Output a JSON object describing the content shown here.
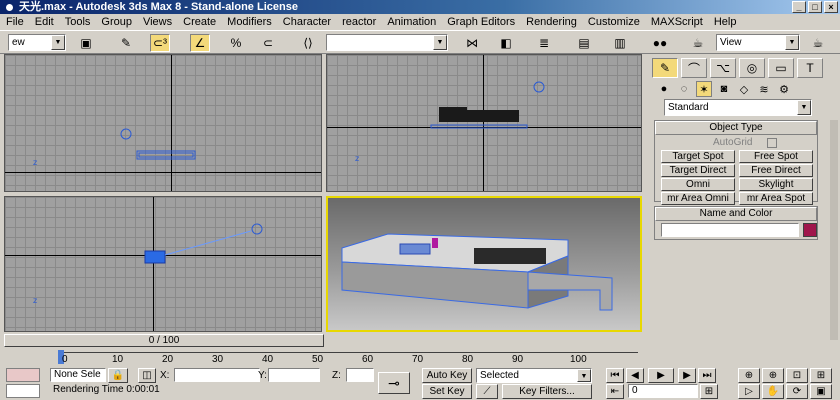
{
  "window": {
    "title": "天光.max - Autodesk 3ds Max 8 - Stand-alone License"
  },
  "menu": [
    "File",
    "Edit",
    "Tools",
    "Group",
    "Views",
    "Create",
    "Modifiers",
    "Character",
    "reactor",
    "Animation",
    "Graph Editors",
    "Rendering",
    "Customize",
    "MAXScript",
    "Help"
  ],
  "toolbar": {
    "selection_filter": "ew",
    "named_selection": "",
    "render_view": "View"
  },
  "command_panel": {
    "dropdown": "Standard",
    "object_type": {
      "title": "Object Type",
      "autogrid": "AutoGrid",
      "buttons": [
        "Target Spot",
        "Free Spot",
        "Target Direct",
        "Free Direct",
        "Omni",
        "Skylight",
        "mr Area Omni",
        "mr Area Spot"
      ]
    },
    "name_color": {
      "title": "Name and Color",
      "name_value": "",
      "swatch_color": "#a0164c"
    }
  },
  "timeline": {
    "range": "0 / 100",
    "ticks": [
      "0",
      "10",
      "20",
      "30",
      "40",
      "50",
      "60",
      "70",
      "80",
      "90",
      "100"
    ]
  },
  "status": {
    "selection": "None Sele",
    "x_label": "X:",
    "y_label": "Y:",
    "z_label": "Z:",
    "x_value": "",
    "y_value": "",
    "z_value": "",
    "prompt": "Rendering Time  0:00:01",
    "auto_key": "Auto Key",
    "set_key": "Set Key",
    "selected": "Selected",
    "key_filters": "Key Filters...",
    "frame": "0"
  },
  "colors": {
    "accent": "#f3d97a",
    "titlebar": "#0a246a",
    "active_viewport_border": "#e8d800"
  }
}
